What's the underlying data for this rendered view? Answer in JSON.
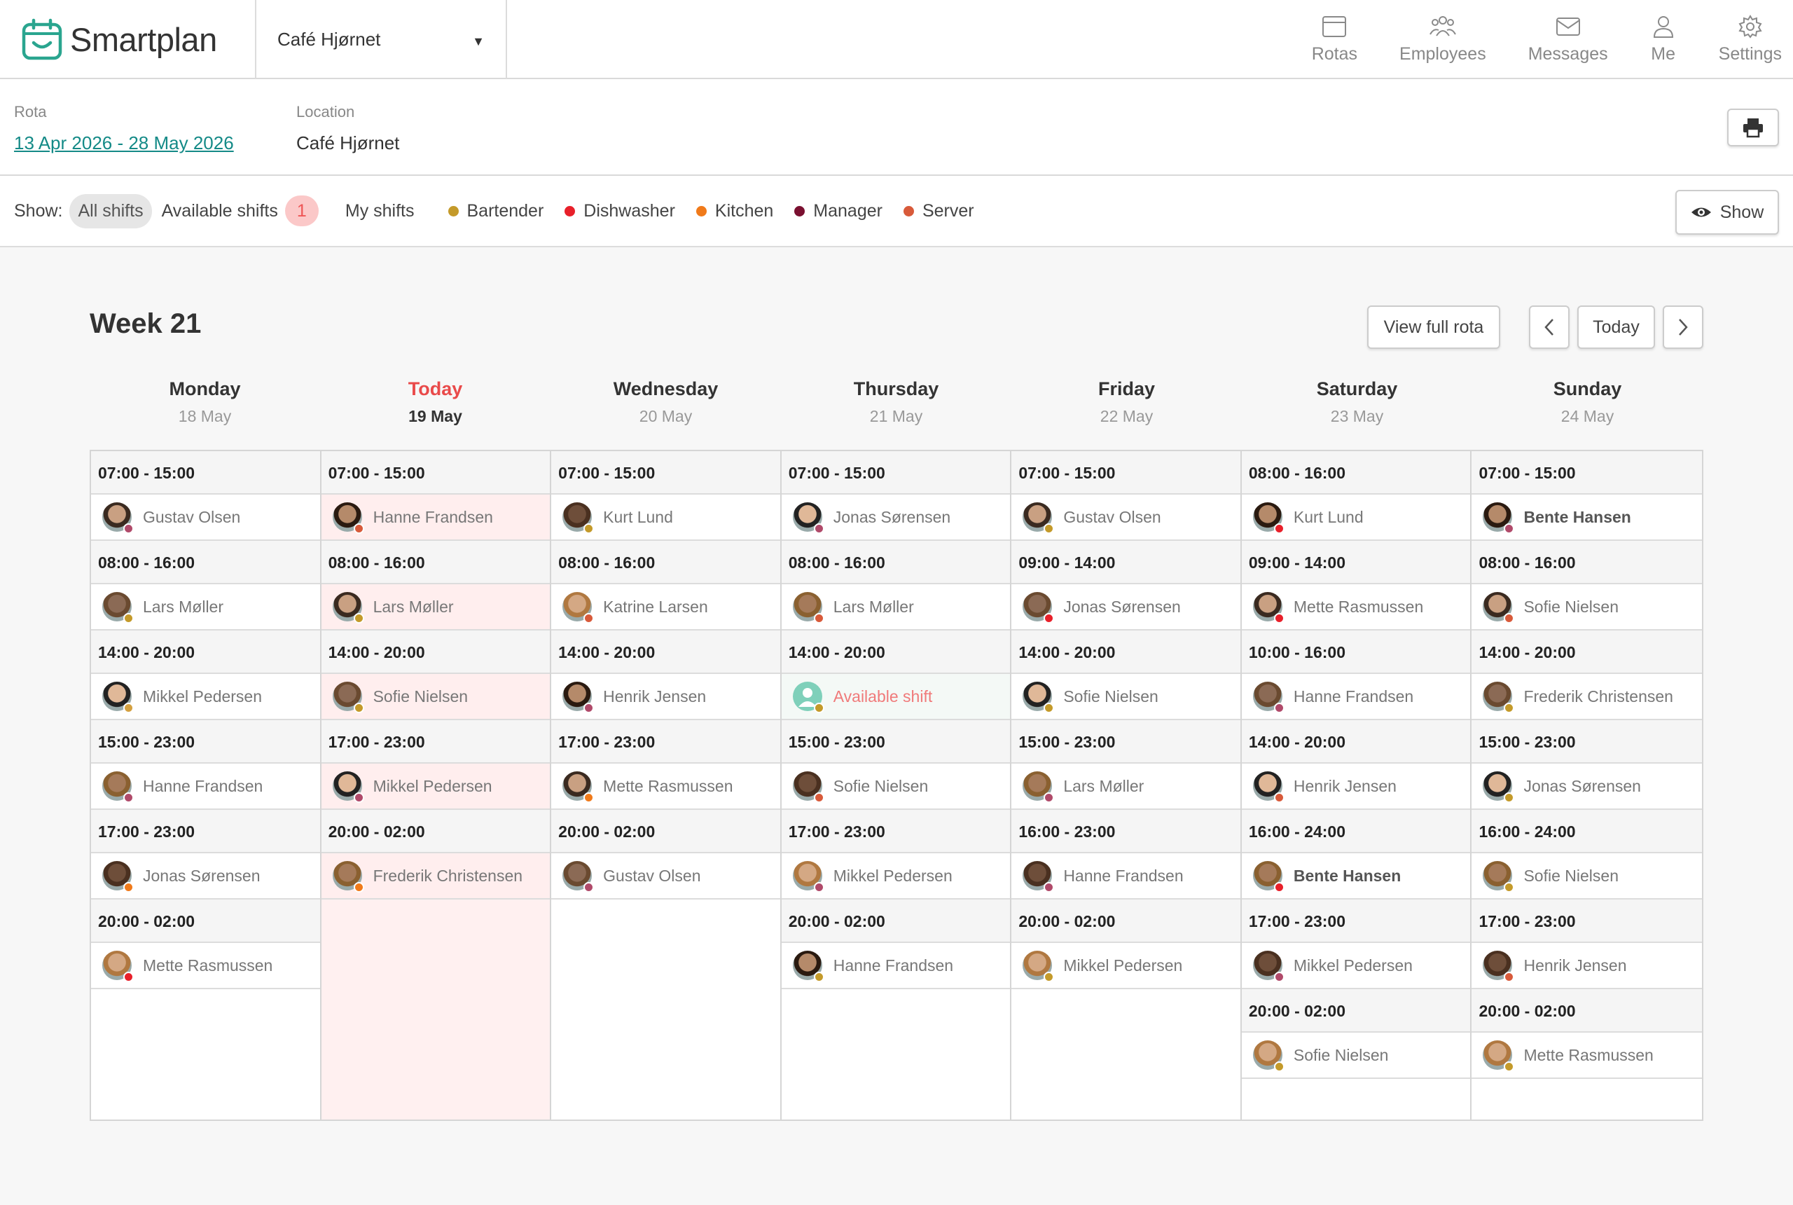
{
  "app": {
    "name": "Smartplan"
  },
  "header": {
    "location_selector": "Café Hjørnet",
    "nav": [
      {
        "label": "Rotas",
        "icon": "calendar-icon"
      },
      {
        "label": "Employees",
        "icon": "people-icon"
      },
      {
        "label": "Messages",
        "icon": "envelope-icon"
      },
      {
        "label": "Me",
        "icon": "user-icon"
      },
      {
        "label": "Settings",
        "icon": "gear-icon"
      }
    ]
  },
  "rota_info": {
    "rota_label": "Rota",
    "rota_value": "13 Apr 2026 - 28 May 2026",
    "location_label": "Location",
    "location_value": "Café Hjørnet"
  },
  "filters": {
    "show_label": "Show:",
    "all_shifts": "All shifts",
    "available_shifts": "Available shifts",
    "available_count": "1",
    "my_shifts": "My shifts",
    "roles": [
      {
        "name": "Bartender",
        "color": "#c49a2a"
      },
      {
        "name": "Dishwasher",
        "color": "#e8202a"
      },
      {
        "name": "Kitchen",
        "color": "#f07a1a"
      },
      {
        "name": "Manager",
        "color": "#7a1030"
      },
      {
        "name": "Server",
        "color": "#d85a3a"
      }
    ],
    "show_button": "Show"
  },
  "week": {
    "title": "Week 21",
    "view_full_rota": "View full rota",
    "today_button": "Today",
    "days": [
      {
        "name": "Monday",
        "date": "18 May",
        "today": false,
        "shifts": [
          {
            "time": "07:00 - 15:00",
            "employee": "Gustav Olsen",
            "role_color": "#b04a6a"
          },
          {
            "time": "08:00 - 16:00",
            "employee": "Lars Møller",
            "role_color": "#c49a2a"
          },
          {
            "time": "14:00 - 20:00",
            "employee": "Mikkel Pedersen",
            "role_color": "#d4a040"
          },
          {
            "time": "15:00 - 23:00",
            "employee": "Hanne Frandsen",
            "role_color": "#b04a6a"
          },
          {
            "time": "17:00 - 23:00",
            "employee": "Jonas Sørensen",
            "role_color": "#f07a1a"
          },
          {
            "time": "20:00 - 02:00",
            "employee": "Mette Rasmussen",
            "role_color": "#e8202a"
          }
        ]
      },
      {
        "name": "Today",
        "date": "19 May",
        "today": true,
        "shifts": [
          {
            "time": "07:00 - 15:00",
            "employee": "Hanne Frandsen",
            "role_color": "#d85a3a"
          },
          {
            "time": "08:00 - 16:00",
            "employee": "Lars Møller",
            "role_color": "#c49a2a"
          },
          {
            "time": "14:00 - 20:00",
            "employee": "Sofie Nielsen",
            "role_color": "#c49a2a"
          },
          {
            "time": "17:00 - 23:00",
            "employee": "Mikkel Pedersen",
            "role_color": "#b04a6a"
          },
          {
            "time": "20:00 - 02:00",
            "employee": "Frederik Christensen",
            "role_color": "#f07a1a"
          }
        ]
      },
      {
        "name": "Wednesday",
        "date": "20 May",
        "today": false,
        "shifts": [
          {
            "time": "07:00 - 15:00",
            "employee": "Kurt Lund",
            "role_color": "#c49a2a"
          },
          {
            "time": "08:00 - 16:00",
            "employee": "Katrine Larsen",
            "role_color": "#d85a3a"
          },
          {
            "time": "14:00 - 20:00",
            "employee": "Henrik Jensen",
            "role_color": "#b04a6a"
          },
          {
            "time": "17:00 - 23:00",
            "employee": "Mette Rasmussen",
            "role_color": "#f07a1a"
          },
          {
            "time": "20:00 - 02:00",
            "employee": "Gustav Olsen",
            "role_color": "#b04a6a"
          }
        ]
      },
      {
        "name": "Thursday",
        "date": "21 May",
        "today": false,
        "shifts": [
          {
            "time": "07:00 - 15:00",
            "employee": "Jonas Sørensen",
            "role_color": "#b04a6a"
          },
          {
            "time": "08:00 - 16:00",
            "employee": "Lars Møller",
            "role_color": "#d85a3a"
          },
          {
            "time": "14:00 - 20:00",
            "employee": "Available shift",
            "role_color": "#c49a2a",
            "available": true
          },
          {
            "time": "15:00 - 23:00",
            "employee": "Sofie Nielsen",
            "role_color": "#d85a3a"
          },
          {
            "time": "17:00 - 23:00",
            "employee": "Mikkel Pedersen",
            "role_color": "#b04a6a"
          },
          {
            "time": "20:00 - 02:00",
            "employee": "Hanne Frandsen",
            "role_color": "#c49a2a"
          }
        ]
      },
      {
        "name": "Friday",
        "date": "22 May",
        "today": false,
        "shifts": [
          {
            "time": "07:00 - 15:00",
            "employee": "Gustav Olsen",
            "role_color": "#c49a2a"
          },
          {
            "time": "09:00 - 14:00",
            "employee": "Jonas Sørensen",
            "role_color": "#e8202a"
          },
          {
            "time": "14:00 - 20:00",
            "employee": "Sofie Nielsen",
            "role_color": "#c49a2a"
          },
          {
            "time": "15:00 - 23:00",
            "employee": "Lars Møller",
            "role_color": "#b04a6a"
          },
          {
            "time": "16:00 - 23:00",
            "employee": "Hanne Frandsen",
            "role_color": "#b04a6a"
          },
          {
            "time": "20:00 - 02:00",
            "employee": "Mikkel Pedersen",
            "role_color": "#c49a2a"
          }
        ]
      },
      {
        "name": "Saturday",
        "date": "23 May",
        "today": false,
        "shifts": [
          {
            "time": "08:00 - 16:00",
            "employee": "Kurt Lund",
            "role_color": "#e8202a"
          },
          {
            "time": "09:00 - 14:00",
            "employee": "Mette Rasmussen",
            "role_color": "#e8202a"
          },
          {
            "time": "10:00 - 16:00",
            "employee": "Hanne Frandsen",
            "role_color": "#b04a6a"
          },
          {
            "time": "14:00 - 20:00",
            "employee": "Henrik Jensen",
            "role_color": "#d85a3a"
          },
          {
            "time": "16:00 - 24:00",
            "employee": "Bente Hansen",
            "role_color": "#e8202a",
            "bold": true
          },
          {
            "time": "17:00 - 23:00",
            "employee": "Mikkel Pedersen",
            "role_color": "#b04a6a"
          },
          {
            "time": "20:00 - 02:00",
            "employee": "Sofie Nielsen",
            "role_color": "#c49a2a"
          }
        ]
      },
      {
        "name": "Sunday",
        "date": "24 May",
        "today": false,
        "shifts": [
          {
            "time": "07:00 - 15:00",
            "employee": "Bente Hansen",
            "role_color": "#b04a6a",
            "bold": true
          },
          {
            "time": "08:00 - 16:00",
            "employee": "Sofie Nielsen",
            "role_color": "#d85a3a"
          },
          {
            "time": "14:00 - 20:00",
            "employee": "Frederik Christensen",
            "role_color": "#c49a2a"
          },
          {
            "time": "15:00 - 23:00",
            "employee": "Jonas Sørensen",
            "role_color": "#c49a2a"
          },
          {
            "time": "16:00 - 24:00",
            "employee": "Sofie Nielsen",
            "role_color": "#c49a2a"
          },
          {
            "time": "17:00 - 23:00",
            "employee": "Henrik Jensen",
            "role_color": "#d85a3a"
          },
          {
            "time": "20:00 - 02:00",
            "employee": "Mette Rasmussen",
            "role_color": "#c49a2a"
          }
        ]
      }
    ]
  }
}
